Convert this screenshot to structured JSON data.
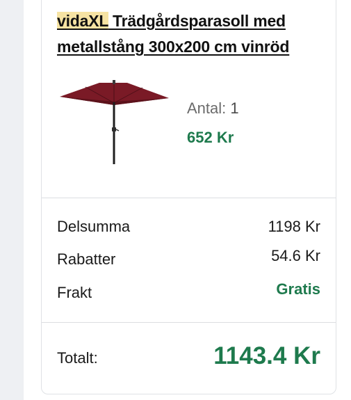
{
  "product": {
    "brand": "vidaXL",
    "title": " Trädgårdsparasoll med metallstång 300x200 cm vinröd",
    "image_icon": "parasol-image",
    "quantity_label": "Antal:",
    "quantity_value": "1",
    "price": "652 Kr"
  },
  "summary": {
    "subtotal_label": "Delsumma",
    "subtotal_value": "1198 Kr",
    "discount_label": "Rabatter",
    "discount_value": "54.6 Kr",
    "shipping_label": "Frakt",
    "shipping_value": "Gratis",
    "total_label": "Totalt:",
    "total_value": "1143.4 Kr"
  },
  "colors": {
    "accent_green": "#1e7a4d",
    "brand_highlight": "#f6e3a3",
    "parasol_red": "#7a1a26"
  }
}
